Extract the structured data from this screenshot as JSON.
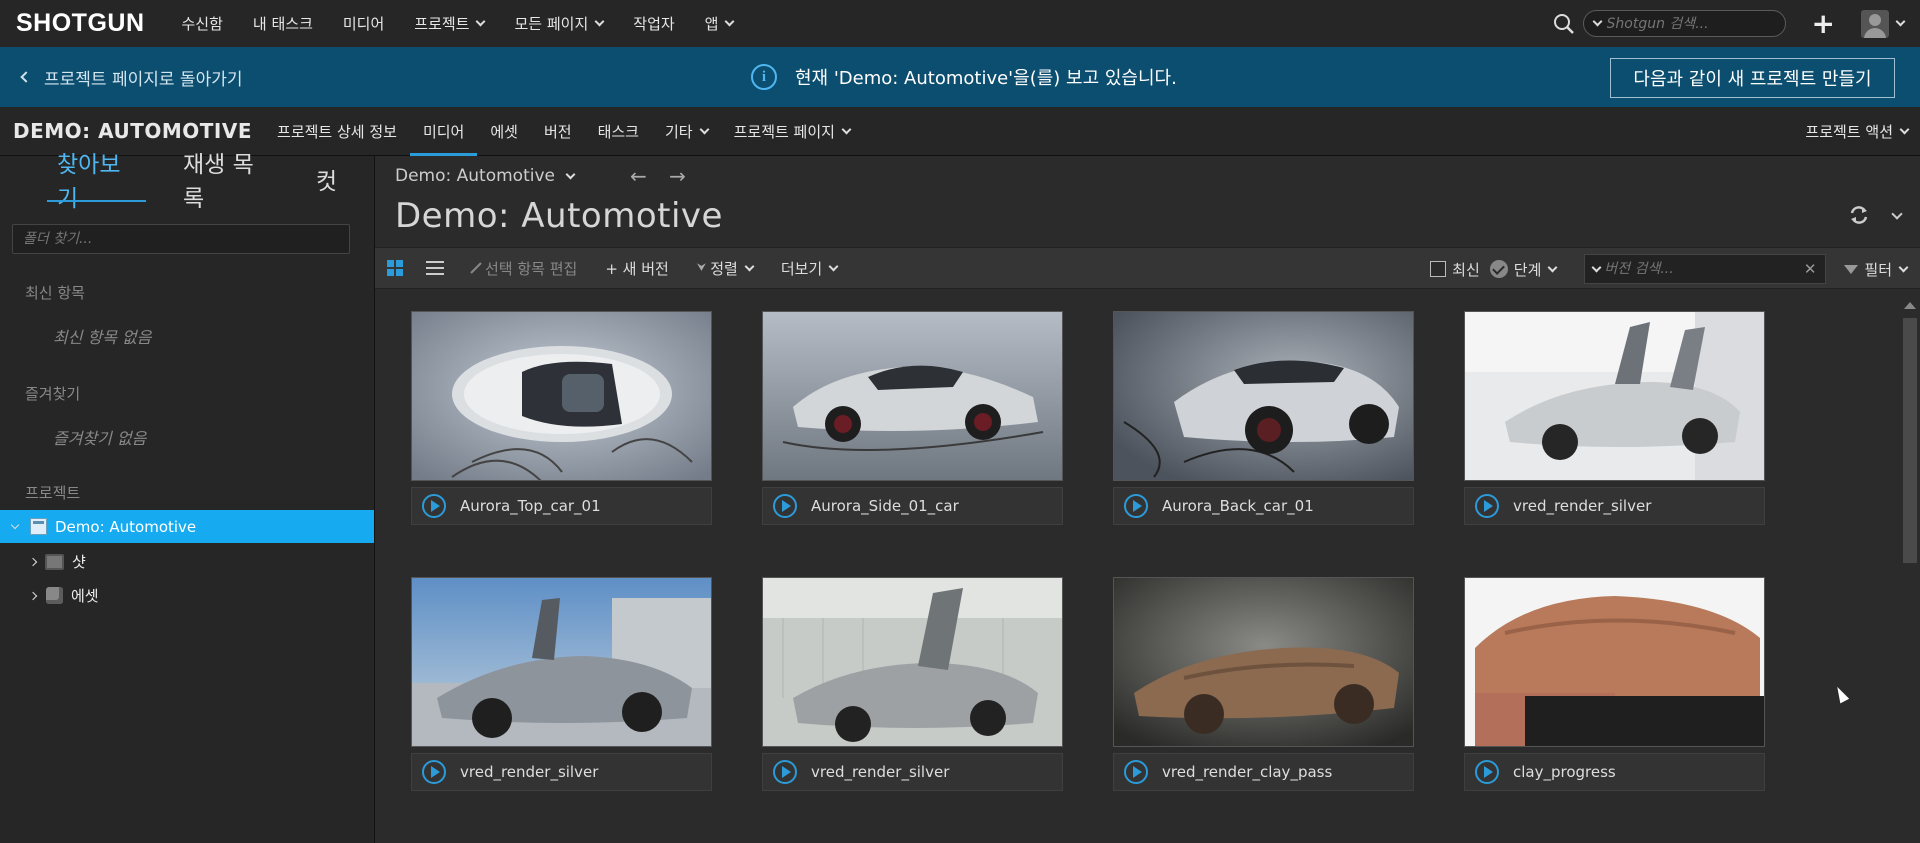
{
  "topbar": {
    "logo": "SHOTGUN",
    "nav": [
      {
        "label": "수신함",
        "dropdown": false
      },
      {
        "label": "내 태스크",
        "dropdown": false
      },
      {
        "label": "미디어",
        "dropdown": false
      },
      {
        "label": "프로젝트",
        "dropdown": true
      },
      {
        "label": "모든 페이지",
        "dropdown": true
      },
      {
        "label": "작업자",
        "dropdown": false
      },
      {
        "label": "앱",
        "dropdown": true
      }
    ],
    "search_placeholder": "Shotgun 검색...",
    "plus": "+"
  },
  "banner": {
    "back": "프로젝트 페이지로 돌아가기",
    "message": "현재 'Demo: Automotive'을(를) 보고 있습니다.",
    "info": "i",
    "button": "다음과 같이 새 프로젝트 만들기"
  },
  "projbar": {
    "title": "DEMO: AUTOMOTIVE",
    "nav": [
      "프로젝트 상세 정보",
      "미디어",
      "에셋",
      "버전",
      "태스크",
      "기타",
      "프로젝트 페이지"
    ],
    "active": "미디어",
    "actions": "프로젝트 액션"
  },
  "sidebar": {
    "tabs": [
      "찾아보기",
      "재생 목록",
      "컷"
    ],
    "folder_placeholder": "폴더 찾기...",
    "recent_head": "최신 항목",
    "recent_empty": "최신 항목 없음",
    "fav_head": "즐겨찾기",
    "fav_empty": "즐겨찾기 없음",
    "proj_head": "프로젝트",
    "tree": [
      {
        "label": "Demo: Automotive",
        "selected": true
      },
      {
        "label": "샷"
      },
      {
        "label": "에셋"
      }
    ]
  },
  "main": {
    "crumb": "Demo: Automotive",
    "arrows": "← →",
    "title": "Demo: Automotive",
    "toolbar": {
      "edit": "선택 항목 편집",
      "new_version": "+ 새 버전",
      "sort": "정렬",
      "more": "더보기",
      "latest": "최신",
      "step": "단계",
      "version_search_placeholder": "버전 검색...",
      "clear": "✕",
      "filter": "필터"
    },
    "versions": [
      {
        "name": "Aurora_Top_car_01",
        "thumb": "top"
      },
      {
        "name": "Aurora_Side_01_car",
        "thumb": "side"
      },
      {
        "name": "Aurora_Back_car_01",
        "thumb": "back"
      },
      {
        "name": "vred_render_silver",
        "thumb": "gull_white"
      },
      {
        "name": "vred_render_silver",
        "thumb": "gull_blue"
      },
      {
        "name": "vred_render_silver",
        "thumb": "gull_gray"
      },
      {
        "name": "vred_render_clay_pass",
        "thumb": "clay_render"
      },
      {
        "name": "clay_progress",
        "thumb": "clay_model"
      }
    ]
  }
}
